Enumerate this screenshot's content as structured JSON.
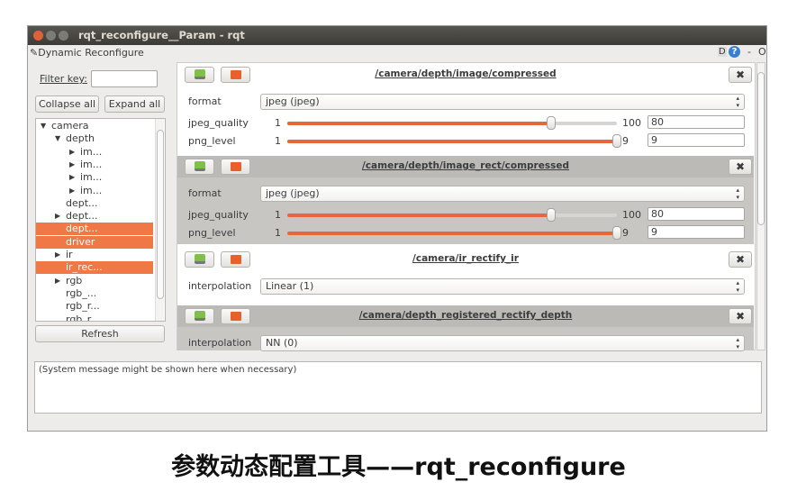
{
  "window": {
    "title": "rqt_reconfigure__Param - rqt",
    "plugin_title": "Dynamic Reconfigure",
    "help_d": "D",
    "help_q": "?",
    "minimize": "-",
    "close": "O"
  },
  "left": {
    "filter_label": "Filter key:",
    "filter_value": "",
    "collapse_all": "Collapse all",
    "expand_all": "Expand all",
    "refresh": "Refresh",
    "tree": [
      {
        "label": "camera",
        "depth": 0,
        "arrow": "▼",
        "sel": false
      },
      {
        "label": "depth",
        "depth": 1,
        "arrow": "▼",
        "sel": false
      },
      {
        "label": "im...",
        "depth": 2,
        "arrow": "▶",
        "sel": false
      },
      {
        "label": "im...",
        "depth": 2,
        "arrow": "▶",
        "sel": false
      },
      {
        "label": "im...",
        "depth": 2,
        "arrow": "▶",
        "sel": false
      },
      {
        "label": "im...",
        "depth": 2,
        "arrow": "▶",
        "sel": false
      },
      {
        "label": "dept...",
        "depth": 1,
        "arrow": "",
        "sel": false
      },
      {
        "label": "dept...",
        "depth": 1,
        "arrow": "▶",
        "sel": false
      },
      {
        "label": "dept...",
        "depth": 1,
        "arrow": "",
        "sel": true
      },
      {
        "label": "driver",
        "depth": 1,
        "arrow": "",
        "sel": true
      },
      {
        "label": "ir",
        "depth": 1,
        "arrow": "▶",
        "sel": false
      },
      {
        "label": "ir_rec...",
        "depth": 1,
        "arrow": "",
        "sel": true
      },
      {
        "label": "rgb",
        "depth": 1,
        "arrow": "▶",
        "sel": false
      },
      {
        "label": "rgb_...",
        "depth": 1,
        "arrow": "",
        "sel": false
      },
      {
        "label": "rgb_r...",
        "depth": 1,
        "arrow": "",
        "sel": false
      },
      {
        "label": "rgb_r...",
        "depth": 1,
        "arrow": "",
        "sel": false
      }
    ]
  },
  "groups": [
    {
      "title": "/camera/depth/image/compressed",
      "shaded": false,
      "params": [
        {
          "name": "format",
          "type": "combo",
          "value": "jpeg (jpeg)"
        },
        {
          "name": "jpeg_quality",
          "type": "slider",
          "min": "1",
          "max": "100",
          "value": "80",
          "fraction": 0.8
        },
        {
          "name": "png_level",
          "type": "slider",
          "min": "1",
          "max": "9",
          "value": "9",
          "fraction": 1.0
        }
      ]
    },
    {
      "title": "/camera/depth/image_rect/compressed",
      "shaded": true,
      "params": [
        {
          "name": "format",
          "type": "combo",
          "value": "jpeg (jpeg)"
        },
        {
          "name": "jpeg_quality",
          "type": "slider",
          "min": "1",
          "max": "100",
          "value": "80",
          "fraction": 0.8
        },
        {
          "name": "png_level",
          "type": "slider",
          "min": "1",
          "max": "9",
          "value": "9",
          "fraction": 1.0
        }
      ]
    },
    {
      "title": "/camera/ir_rectify_ir",
      "shaded": false,
      "params": [
        {
          "name": "interpolation",
          "type": "combo",
          "value": "Linear (1)"
        }
      ]
    },
    {
      "title": "/camera/depth_registered_rectify_depth",
      "shaded": true,
      "params": [
        {
          "name": "interpolation",
          "type": "combo",
          "value": "NN (0)"
        }
      ]
    }
  ],
  "message": "(System message might be shown here when necessary)",
  "caption": "参数动态配置工具——rqt_reconfigure",
  "colors": {
    "accent": "#f07746",
    "slider_fill": "#e8673a",
    "shaded_group": "#c8c6c2"
  }
}
